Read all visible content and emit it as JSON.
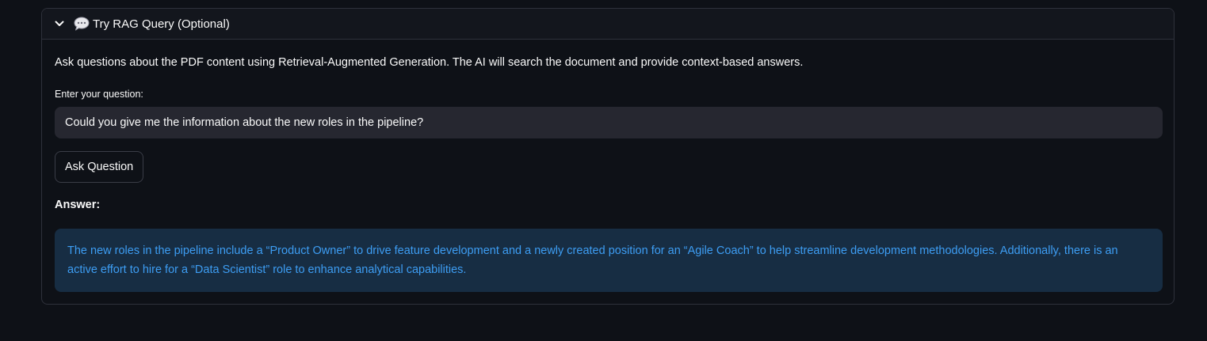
{
  "expander": {
    "title": "Try RAG Query (Optional)",
    "icon": "speech-bubble-icon",
    "chevron_icon": "chevron-down-icon",
    "expanded": true
  },
  "body": {
    "description": "Ask questions about the PDF content using Retrieval-Augmented Generation. The AI will search the document and provide context-based answers.",
    "question_label": "Enter your question:",
    "question_value": "Could you give me the information about the new roles in the pipeline?",
    "ask_button_label": "Ask Question",
    "answer_label": "Answer:",
    "answer_text": "The new roles in the pipeline include a “Product Owner” to drive feature development and a newly created position for an “Agile Coach” to help streamline development methodologies. Additionally, there is an active effort to hire for a “Data Scientist” role to enhance analytical capabilities."
  },
  "colors": {
    "background": "#0e1117",
    "input_background": "#262730",
    "answer_background": "#172d43",
    "answer_text": "#3d9df3",
    "border": "#2e313b"
  }
}
